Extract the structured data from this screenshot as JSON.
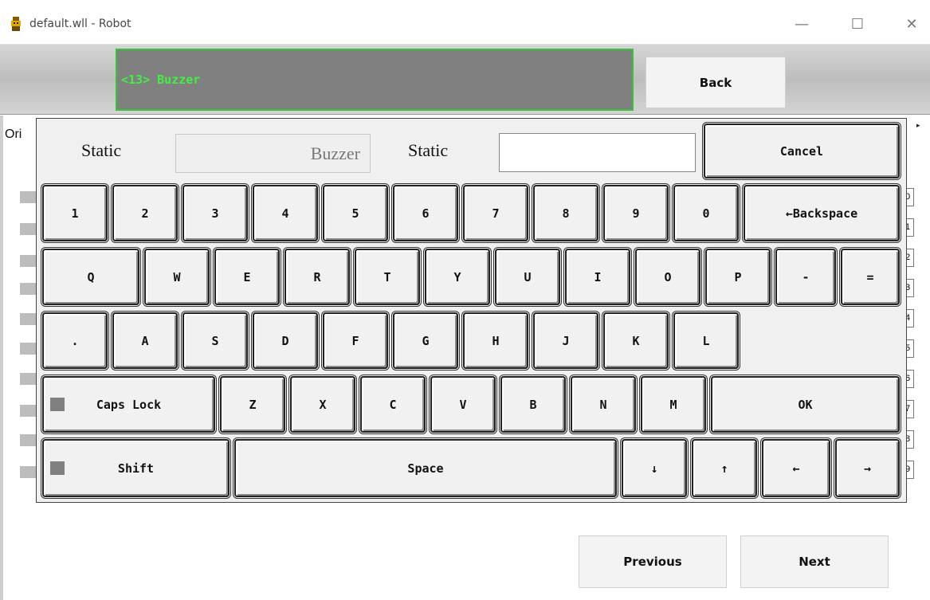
{
  "window": {
    "title": "default.wll - Robot",
    "icon": "robot-icon",
    "minimize": "—",
    "maximize": "☐",
    "close": "✕"
  },
  "header": {
    "current_label": "<13> Buzzer",
    "back_label": "Back"
  },
  "background": {
    "ori_label": "Ori",
    "right_digits": [
      "0",
      "1",
      "2",
      "3",
      "4",
      "5",
      "6",
      "7",
      "8",
      "9"
    ],
    "scroll_arrow": "▸"
  },
  "keyboard": {
    "static_label_1": "Static",
    "static_field_value": "Buzzer",
    "static_label_2": "Static",
    "input_value": "",
    "cancel_label": "Cancel",
    "row1": [
      "1",
      "2",
      "3",
      "4",
      "5",
      "6",
      "7",
      "8",
      "9",
      "0"
    ],
    "backspace_label": "←Backspace",
    "row2": [
      "Q",
      "W",
      "E",
      "R",
      "T",
      "Y",
      "U",
      "I",
      "O",
      "P",
      "-",
      "="
    ],
    "row3": [
      ".",
      "A",
      "S",
      "D",
      "F",
      "G",
      "H",
      "J",
      "K",
      "L"
    ],
    "capslock_label": "Caps Lock",
    "row4": [
      "Z",
      "X",
      "C",
      "V",
      "B",
      "N",
      "M"
    ],
    "ok_label": "OK",
    "shift_label": "Shift",
    "space_label": "Space",
    "arrows": [
      "↓",
      "↑",
      "←",
      "→"
    ]
  },
  "footer": {
    "previous_label": "Previous",
    "next_label": "Next"
  }
}
